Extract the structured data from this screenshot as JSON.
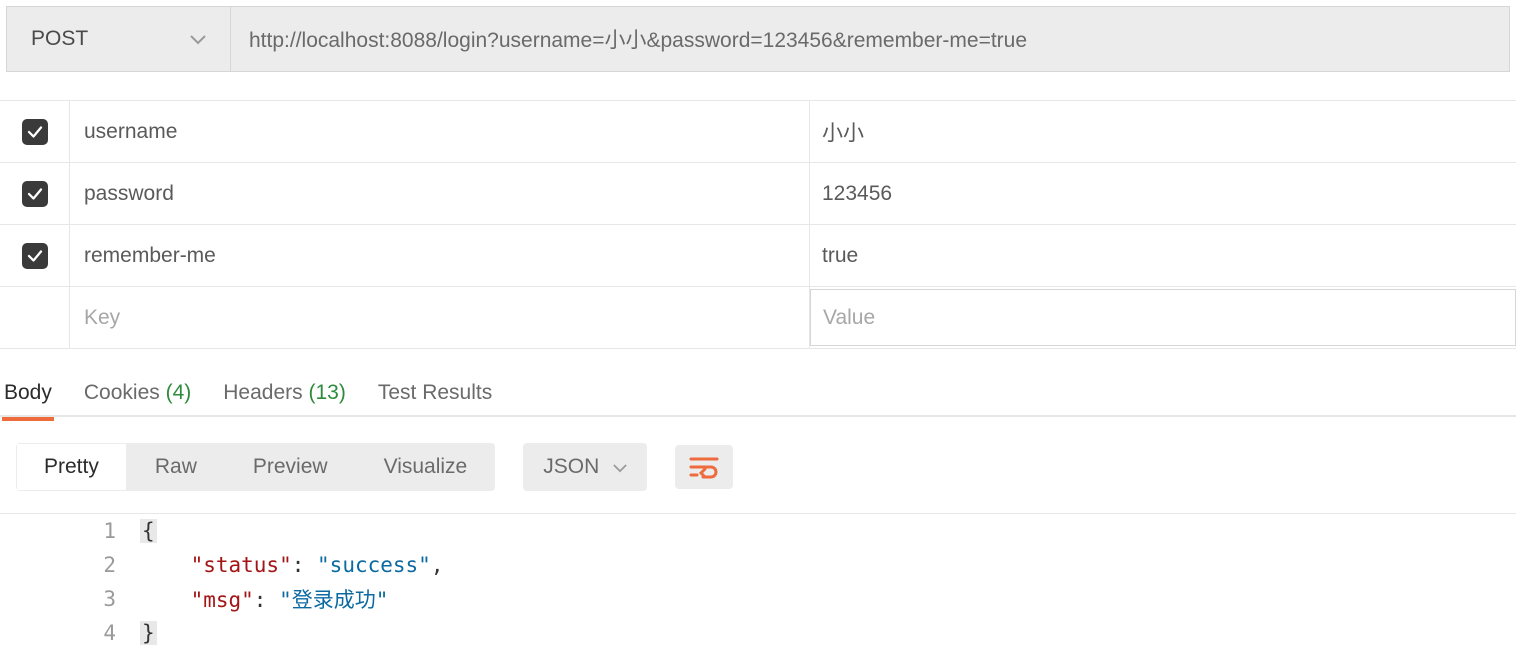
{
  "request": {
    "method": "POST",
    "url": "http://localhost:8088/login?username=小小&password=123456&remember-me=true"
  },
  "params": {
    "rows": [
      {
        "enabled": true,
        "key": "username",
        "value": "小小"
      },
      {
        "enabled": true,
        "key": "password",
        "value": "123456"
      },
      {
        "enabled": true,
        "key": "remember-me",
        "value": "true"
      }
    ],
    "placeholder_key": "Key",
    "placeholder_value": "Value"
  },
  "response_tabs": {
    "body": "Body",
    "cookies": "Cookies",
    "cookies_count": "(4)",
    "headers_label": "Headers",
    "headers_count": "(13)",
    "test_results": "Test Results"
  },
  "body_toolbar": {
    "pretty": "Pretty",
    "raw": "Raw",
    "preview": "Preview",
    "visualize": "Visualize",
    "format": "JSON"
  },
  "json_body": {
    "status_key": "\"status\"",
    "status_val": "\"success\"",
    "msg_key": "\"msg\"",
    "msg_val": "\"登录成功\"",
    "line_numbers": [
      "1",
      "2",
      "3",
      "4"
    ],
    "brace_open": "{",
    "brace_close": "}",
    "colon_sp": ": ",
    "comma": ",",
    "indent": "    "
  }
}
